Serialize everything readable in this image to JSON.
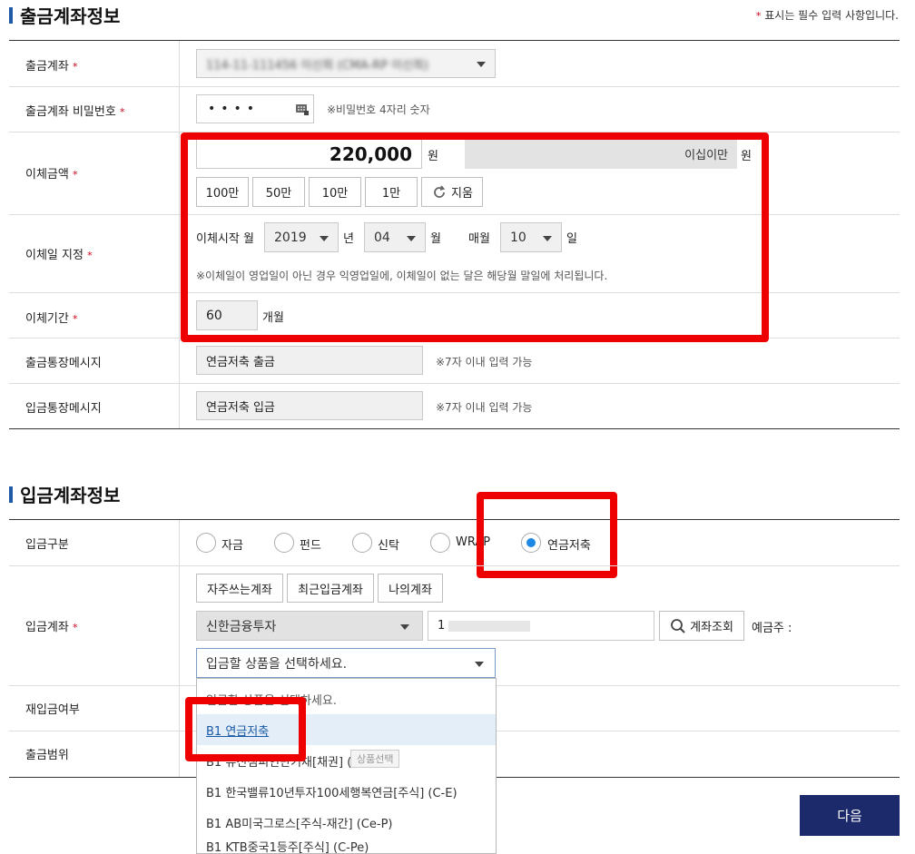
{
  "withdraw": {
    "title": "출금계좌정보",
    "required_note": "표시는 필수 입력 사항입니다.",
    "star": "*",
    "rows": {
      "account_label": "출금계좌",
      "account_value": "114-11-111456 이신희 (CMA-RP 이신희)",
      "password_label": "출금계좌 비밀번호",
      "password_value": "••••",
      "password_note": "※비밀번호 4자리 숫자",
      "amount_label": "이체금액",
      "amount_value": "220,000",
      "amount_unit": "원",
      "amount_korean": "이십이만",
      "amount_korean_unit": "원",
      "quick_buttons": [
        "100만",
        "50만",
        "10만",
        "1만"
      ],
      "clear_label": "지움",
      "date_label": "이체일 지정",
      "start_label": "이체시작 월",
      "year_value": "2019",
      "year_unit": "년",
      "month_value": "04",
      "month_unit": "월",
      "monthly_label": "매월",
      "day_value": "10",
      "day_unit": "일",
      "date_note": "※이체일이 영업일이 아닌 경우 익영업일에, 이체일이 없는 달은 해당월 말일에 처리됩니다.",
      "period_label": "이체기간",
      "period_value": "60",
      "period_unit": "개월",
      "out_msg_label": "출금통장메시지",
      "out_msg_value": "연금저축 출금",
      "out_msg_note": "※7자 이내 입력 가능",
      "in_msg_label": "입금통장메시지",
      "in_msg_value": "연금저축 입금",
      "in_msg_note": "※7자 이내 입력 가능"
    }
  },
  "deposit": {
    "title": "입금계좌정보",
    "type_label": "입금구분",
    "types": [
      "자금",
      "펀드",
      "신탁",
      "WRAP",
      "연금저축"
    ],
    "selected_type": "연금저축",
    "account_label": "입금계좌",
    "account_buttons": [
      "자주쓰는계좌",
      "최근입금계좌",
      "나의계좌"
    ],
    "bank_value": "신한금융투자",
    "account_number_value": "1",
    "lookup_label": "계좌조회",
    "holder_label": "예금주 : ",
    "product_placeholder": "입금할 상품을 선택하세요.",
    "redeposit_label": "재입금여부",
    "range_label": "출금범위",
    "dropdown_options": [
      "입금할 상품을 선택하세요.",
      "B1 연금저축",
      "B1 유진챔피언단기채[채권] (C-Pe)",
      "B1 한국밸류10년투자100세행복연금[주식] (C-E)",
      "B1 AB미국그로스[주식-재간] (Ce-P)",
      "B1 KTB중국1등주[주식] (C-Pe)"
    ],
    "tooltip_text": "상품선택"
  },
  "next_button": "다음",
  "colors": {
    "accent_blue": "#1f5aa6",
    "highlight_red": "#ee0000",
    "next_button_bg": "#1c2a6b",
    "radio_selected": "#1e88e5",
    "required_star": "#d0021b"
  }
}
